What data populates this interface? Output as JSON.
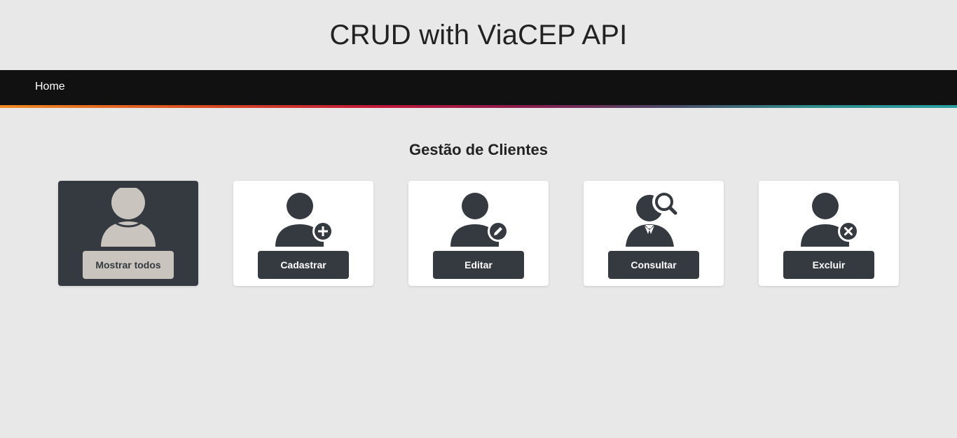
{
  "header": {
    "title": "CRUD with ViaCEP API"
  },
  "nav": {
    "home_label": "Home"
  },
  "section": {
    "title": "Gestão de Clientes"
  },
  "cards": [
    {
      "label": "Mostrar todos",
      "icon": "user-icon",
      "active": true
    },
    {
      "label": "Cadastrar",
      "icon": "user-add-icon",
      "active": false
    },
    {
      "label": "Editar",
      "icon": "user-edit-icon",
      "active": false
    },
    {
      "label": "Consultar",
      "icon": "user-search-icon",
      "active": false
    },
    {
      "label": "Excluir",
      "icon": "user-delete-icon",
      "active": false
    }
  ],
  "colors": {
    "background": "#e8e8e8",
    "navbar": "#111111",
    "dark": "#343a40",
    "active_button": "#c9c4bd",
    "active_icon": "#c9c4bd"
  }
}
